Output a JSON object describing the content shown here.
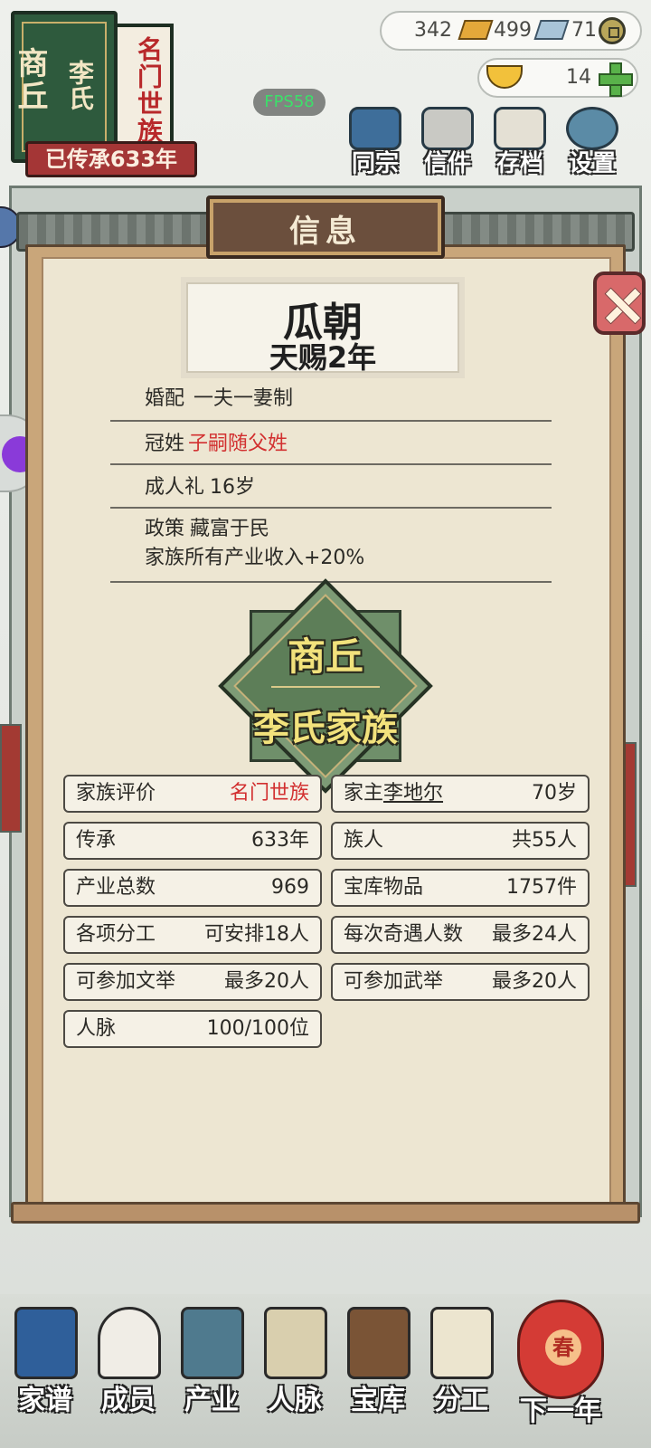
{
  "header": {
    "book": {
      "place": "商丘",
      "clan": "李氏",
      "rank_tag": "名门世族"
    },
    "inheritance_banner": "已传承633年",
    "currencies": {
      "gold": "342",
      "silver": "499",
      "coin": "71",
      "ingot": "14"
    },
    "fps": "FPS58",
    "menu": [
      {
        "label": "同宗",
        "icon": "clan-book-icon"
      },
      {
        "label": "信件",
        "icon": "letters-icon"
      },
      {
        "label": "存档",
        "icon": "archive-icon"
      },
      {
        "label": "设置",
        "icon": "settings-icon"
      }
    ]
  },
  "panel": {
    "title": "信息",
    "era": {
      "name": "瓜朝",
      "year": "天赐2年"
    },
    "policies": {
      "marriage_label": "婚配",
      "marriage_value": "一夫一妻制",
      "surname_label": "冠姓",
      "surname_value": "子嗣随父姓",
      "adulthood_label": "成人礼",
      "adulthood_value": "16岁",
      "policy_label": "政策",
      "policy_value": "藏富于民",
      "policy_effect": "家族所有产业收入+20%"
    },
    "emblem": {
      "line1": "商丘",
      "line2": "李氏家族"
    },
    "stats": {
      "rating_label": "家族评价",
      "rating_value": "名门世族",
      "head_label": "家主",
      "head_name": "李地尔",
      "head_age": "70岁",
      "inherit_label": "传承",
      "inherit_value": "633年",
      "members_label": "族人",
      "members_value": "共55人",
      "industry_label": "产业总数",
      "industry_value": "969",
      "treasury_label": "宝库物品",
      "treasury_value": "1757件",
      "labor_label": "各项分工",
      "labor_value": "可安排18人",
      "encounter_label": "每次奇遇人数",
      "encounter_value": "最多24人",
      "civil_exam_label": "可参加文举",
      "civil_exam_value": "最多20人",
      "military_exam_label": "可参加武举",
      "military_exam_value": "最多20人",
      "network_label": "人脉",
      "network_value": "100/100位"
    }
  },
  "nav": {
    "items": [
      {
        "label": "家谱",
        "icon": "genealogy-icon"
      },
      {
        "label": "成员",
        "icon": "members-icon"
      },
      {
        "label": "产业",
        "icon": "industry-icon"
      },
      {
        "label": "人脉",
        "icon": "network-icon"
      },
      {
        "label": "宝库",
        "icon": "treasury-icon"
      },
      {
        "label": "分工",
        "icon": "division-icon"
      }
    ],
    "next_year": "下一年",
    "lantern_char": "春"
  },
  "colors": {
    "accent_red": "#d23030",
    "panel_paper": "#ede6d2",
    "emblem_green": "#5d7e58",
    "fps_green": "#3ce06a"
  }
}
